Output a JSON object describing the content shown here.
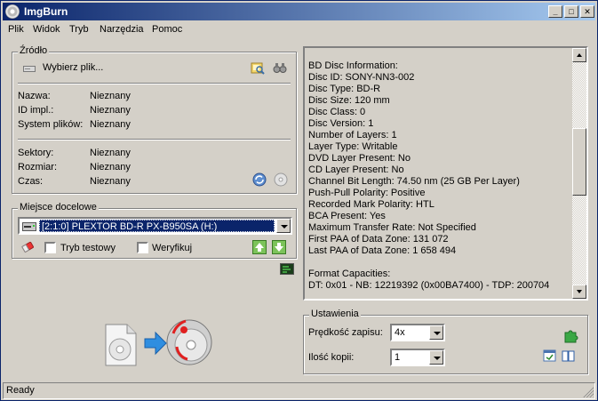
{
  "window": {
    "title": "ImgBurn"
  },
  "title_buttons": {
    "minimize": "_",
    "maximize": "□",
    "close": "✕"
  },
  "menu": [
    {
      "label": "Plik"
    },
    {
      "label": "Widok"
    },
    {
      "label": "Tryb"
    },
    {
      "label": "Narzędzia"
    },
    {
      "label": "Pomoc"
    }
  ],
  "source": {
    "title": "Źródło",
    "browse_label": "Wybierz plik...",
    "rows": [
      {
        "label": "Nazwa:",
        "value": "Nieznany"
      },
      {
        "label": "ID impl.:",
        "value": "Nieznany"
      },
      {
        "label": "System plików:",
        "value": "Nieznany"
      }
    ],
    "rows2": [
      {
        "label": "Sektory:",
        "value": "Nieznany"
      },
      {
        "label": "Rozmiar:",
        "value": "Nieznany"
      },
      {
        "label": "Czas:",
        "value": "Nieznany"
      }
    ]
  },
  "destination": {
    "title": "Miejsce docelowe",
    "drive": "[2:1:0] PLEXTOR BD-R  PX-B950SA (H:)",
    "test_mode_label": "Tryb testowy",
    "verify_label": "Weryfikuj"
  },
  "info": {
    "lines": [
      "BD Disc Information:",
      "Disc ID: SONY-NN3-002",
      "Disc Type: BD-R",
      "Disc Size: 120 mm",
      "Disc Class: 0",
      "Disc Version: 1",
      "Number of Layers: 1",
      "Layer Type: Writable",
      "DVD Layer Present: No",
      "CD Layer Present: No",
      "Channel Bit Length: 74.50 nm (25 GB Per Layer)",
      "Push-Pull Polarity: Positive",
      "Recorded Mark Polarity: HTL",
      "BCA Present: Yes",
      "Maximum Transfer Rate: Not Specified",
      "First PAA of Data Zone: 131 072",
      "Last PAA of Data Zone: 1 658 494",
      "",
      "Format Capacities:",
      "DT: 0x01 - NB: 12219392 (0x00BA7400) - TDP: 200704"
    ]
  },
  "settings": {
    "title": "Ustawienia",
    "speed_label": "Prędkość zapisu:",
    "speed_value": "4x",
    "copies_label": "Ilość kopii:",
    "copies_value": "1"
  },
  "status": {
    "text": "Ready"
  },
  "colors": {
    "titlebar_start": "#0a246a",
    "titlebar_end": "#a6caf0",
    "selection": "#0a246a",
    "face": "#d4d0c8"
  }
}
